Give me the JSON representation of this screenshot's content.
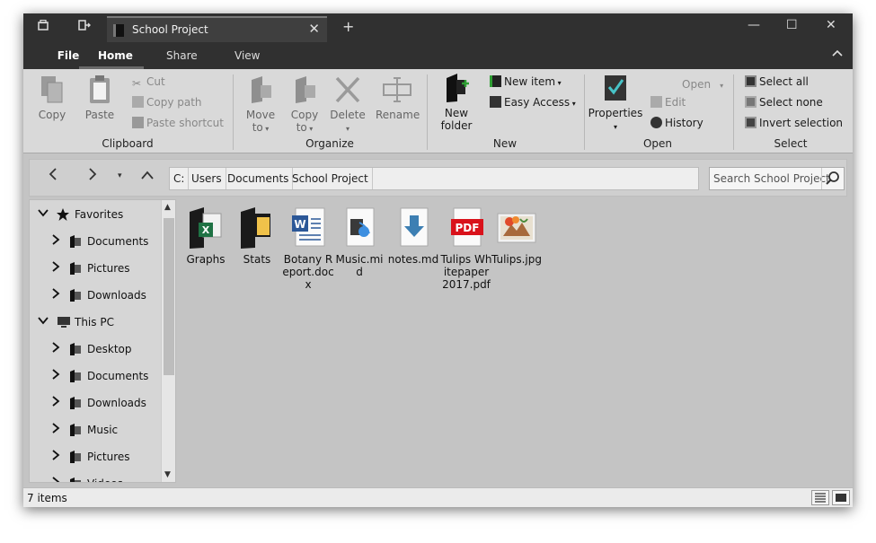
{
  "window": {
    "tab_title": "School Project",
    "tab_close": "✕",
    "new_tab": "+",
    "minimize": "—",
    "maximize": "☐",
    "close": "✕"
  },
  "menu": {
    "file": "File",
    "tabs": [
      "Home",
      "Share",
      "View"
    ],
    "active_tab": "Home"
  },
  "ribbon": {
    "clipboard": {
      "label": "Clipboard",
      "copy": "Copy",
      "paste": "Paste",
      "cut": "Cut",
      "copy_path": "Copy path",
      "paste_shortcut": "Paste shortcut"
    },
    "organize": {
      "label": "Organize",
      "move_to": "Move",
      "move_to2": "to",
      "copy_to": "Copy",
      "copy_to2": "to",
      "delete": "Delete",
      "rename": "Rename"
    },
    "new": {
      "label": "New",
      "new_folder": "New",
      "new_folder2": "folder",
      "new_item": "New item",
      "easy_access": "Easy Access"
    },
    "open": {
      "label": "Open",
      "properties": "Properties",
      "open": "Open",
      "edit": "Edit",
      "history": "History"
    },
    "select": {
      "label": "Select",
      "select_all": "Select all",
      "select_none": "Select none",
      "invert_selection": "Invert selection"
    }
  },
  "address": {
    "crumbs": [
      "C:",
      "Users",
      "Documents",
      "School Project"
    ],
    "search_placeholder": "Search School Project"
  },
  "sidebar": {
    "items": [
      {
        "label": "Favorites",
        "level": 0,
        "expanded": true,
        "icon": "star-icon"
      },
      {
        "label": "Documents",
        "level": 1,
        "expanded": false,
        "icon": "documents-folder-icon"
      },
      {
        "label": "Pictures",
        "level": 1,
        "expanded": false,
        "icon": "pictures-folder-icon"
      },
      {
        "label": "Downloads",
        "level": 1,
        "expanded": false,
        "icon": "downloads-folder-icon"
      },
      {
        "label": "This PC",
        "level": 0,
        "expanded": true,
        "icon": "computer-icon"
      },
      {
        "label": "Desktop",
        "level": 1,
        "expanded": false,
        "icon": "desktop-folder-icon"
      },
      {
        "label": "Documents",
        "level": 1,
        "expanded": false,
        "icon": "documents-folder-icon"
      },
      {
        "label": "Downloads",
        "level": 1,
        "expanded": false,
        "icon": "downloads-folder-icon"
      },
      {
        "label": "Music",
        "level": 1,
        "expanded": false,
        "icon": "music-folder-icon"
      },
      {
        "label": "Pictures",
        "level": 1,
        "expanded": false,
        "icon": "pictures-folder-icon"
      },
      {
        "label": "Videos",
        "level": 1,
        "expanded": false,
        "icon": "videos-folder-icon"
      }
    ]
  },
  "files": [
    {
      "name": "Graphs",
      "type": "excel-folder"
    },
    {
      "name": "Stats",
      "type": "folder"
    },
    {
      "name": "Botany Report.docx",
      "type": "word"
    },
    {
      "name": "Music.mid",
      "type": "audio"
    },
    {
      "name": "notes.md",
      "type": "download"
    },
    {
      "name": "Tulips Whitepaper 2017.pdf",
      "type": "pdf"
    },
    {
      "name": "Tulips.jpg",
      "type": "image"
    }
  ],
  "status": {
    "item_count": "7 items"
  },
  "colors": {
    "titlebar": "#303030",
    "ribbon": "#d9d9d9",
    "content": "#c4c4c4",
    "pdf_red": "#d9121b",
    "word_blue": "#2b5797",
    "excel_green": "#1f7244"
  }
}
